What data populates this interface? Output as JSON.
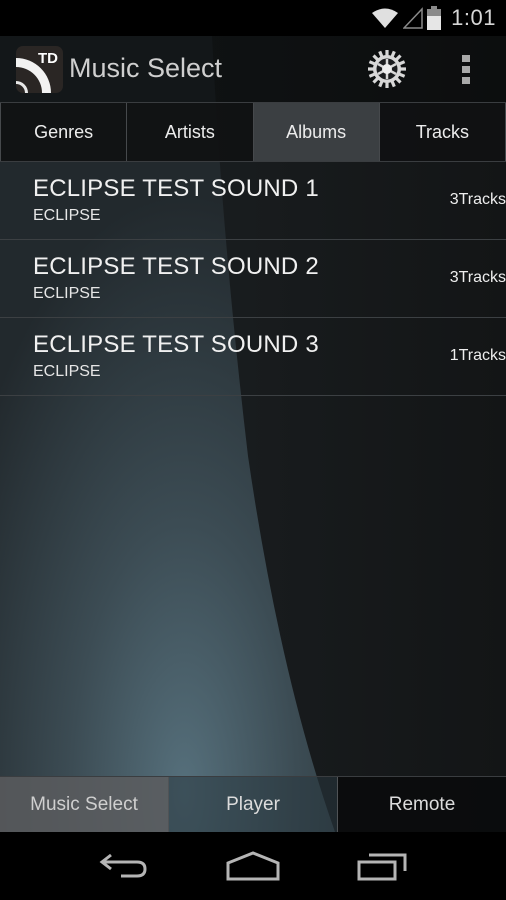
{
  "status_bar": {
    "time": "1:01",
    "icons": [
      "wifi-icon",
      "signal-icon",
      "battery-icon"
    ]
  },
  "action_bar": {
    "logo_text": "TD",
    "title": "Music Select",
    "settings_icon": "gear-icon",
    "overflow_icon": "more-vert-icon"
  },
  "tabs": [
    {
      "label": "Genres",
      "active": false
    },
    {
      "label": "Artists",
      "active": false
    },
    {
      "label": "Albums",
      "active": true
    },
    {
      "label": "Tracks",
      "active": false
    }
  ],
  "albums": [
    {
      "title": "ECLIPSE TEST SOUND 1",
      "artist": "ECLIPSE",
      "count": "3Tracks"
    },
    {
      "title": "ECLIPSE TEST SOUND 2",
      "artist": "ECLIPSE",
      "count": "3Tracks"
    },
    {
      "title": "ECLIPSE TEST SOUND 3",
      "artist": "ECLIPSE",
      "count": "1Tracks"
    }
  ],
  "bottom_tabs": [
    {
      "label": "Music Select",
      "active": true
    },
    {
      "label": "Player",
      "active": false
    },
    {
      "label": "Remote",
      "active": false
    }
  ],
  "nav_bar": {
    "back": "back-icon",
    "home": "home-icon",
    "recents": "recents-icon"
  }
}
